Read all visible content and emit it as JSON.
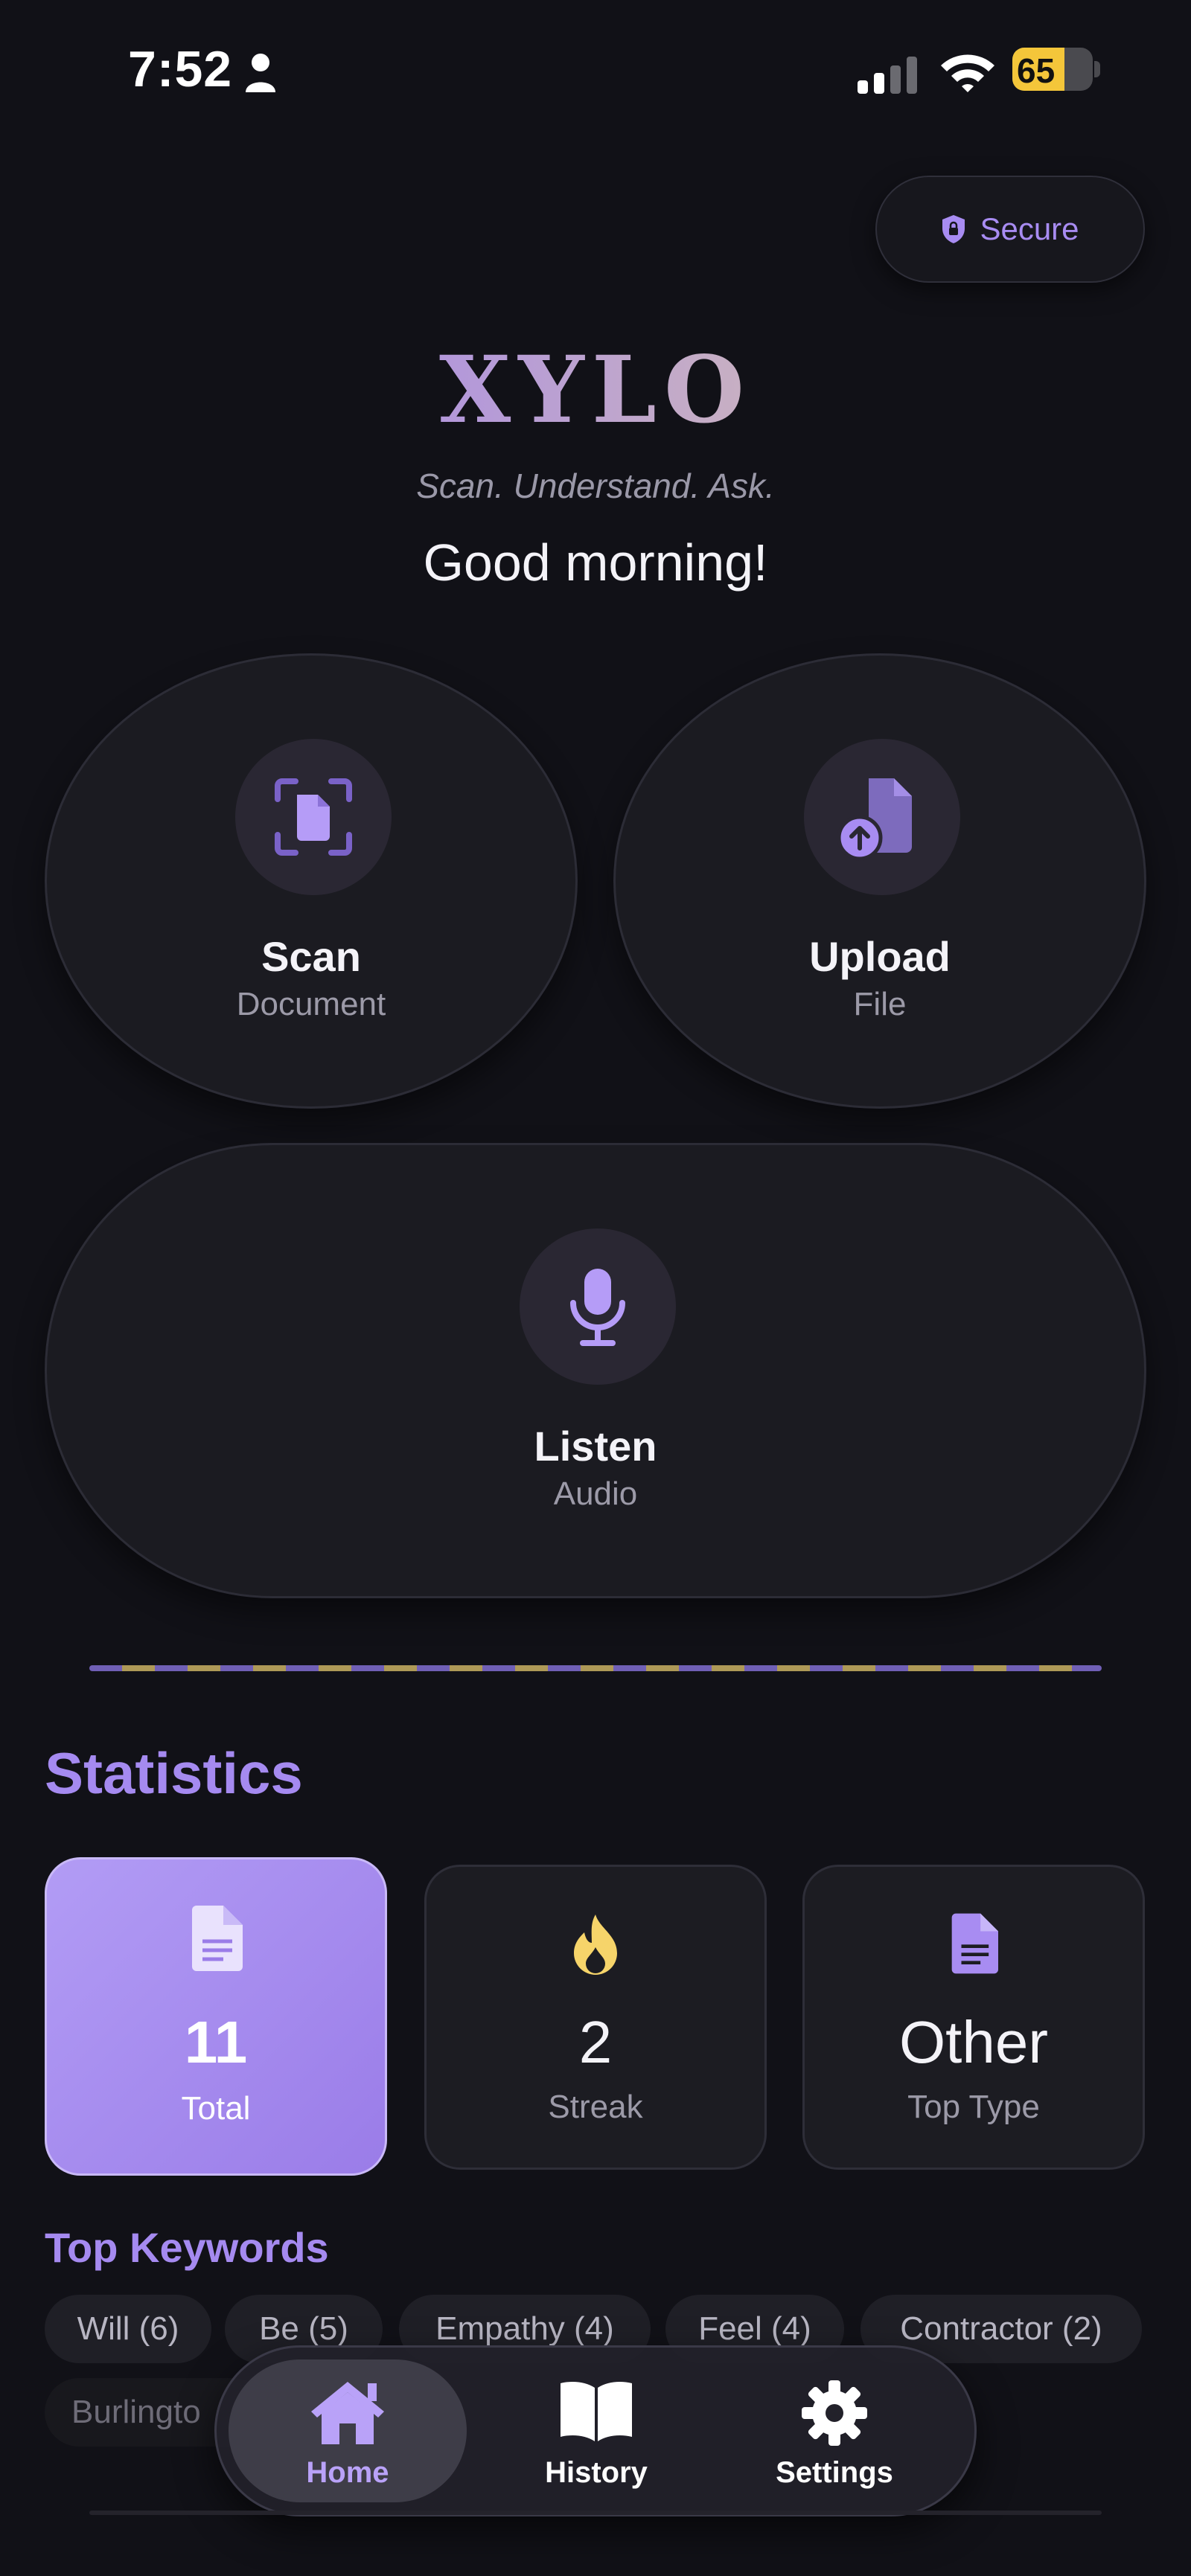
{
  "status_bar": {
    "time": "7:52",
    "battery_percent": "65",
    "battery_level": 0.65
  },
  "header": {
    "secure_label": "Secure",
    "logo": "XYLO",
    "tagline": "Scan. Understand. Ask.",
    "greeting": "Good morning!"
  },
  "actions": {
    "scan": {
      "title": "Scan",
      "subtitle": "Document",
      "icon": "scan-document-icon"
    },
    "upload": {
      "title": "Upload",
      "subtitle": "File",
      "icon": "upload-file-icon"
    },
    "listen": {
      "title": "Listen",
      "subtitle": "Audio",
      "icon": "microphone-icon"
    }
  },
  "statistics": {
    "heading": "Statistics",
    "total": {
      "value": "11",
      "label": "Total",
      "icon": "document-icon"
    },
    "streak": {
      "value": "2",
      "label": "Streak",
      "icon": "flame-icon"
    },
    "top_type": {
      "value": "Other",
      "label": "Top Type",
      "icon": "document-icon"
    }
  },
  "keywords": {
    "heading": "Top Keywords",
    "items": [
      "Will (6)",
      "Be (5)",
      "Empathy (4)",
      "Feel (4)",
      "Contractor (2)",
      "Burlingto"
    ]
  },
  "tabbar": {
    "active": "Home",
    "items": [
      {
        "label": "Home",
        "icon": "home-icon"
      },
      {
        "label": "History",
        "icon": "book-icon"
      },
      {
        "label": "Settings",
        "icon": "gear-icon"
      }
    ]
  },
  "colors": {
    "background": "#111117",
    "accent": "#a58af0",
    "gold": "#e6d3a0"
  }
}
